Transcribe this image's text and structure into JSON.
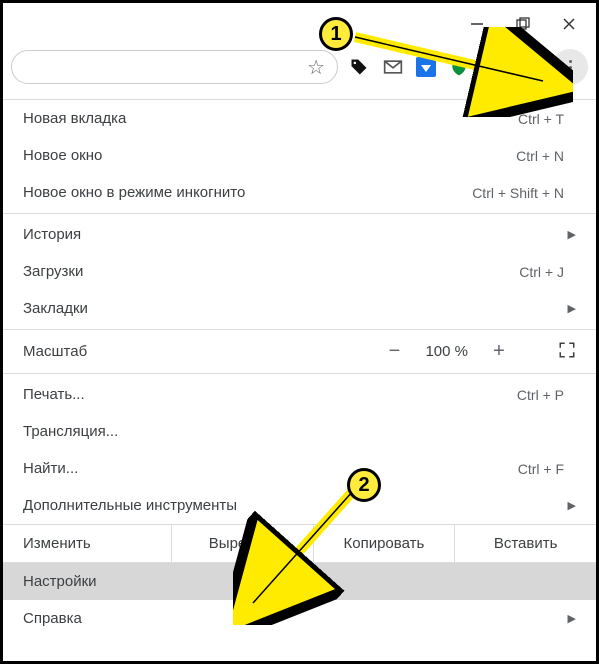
{
  "window": {
    "minimize": "—",
    "maximize": "❐",
    "close": "✕"
  },
  "toolbar": {
    "star": "☆"
  },
  "menu": {
    "new_tab": {
      "label": "Новая вкладка",
      "shortcut": "Ctrl + T"
    },
    "new_window": {
      "label": "Новое окно",
      "shortcut": "Ctrl + N"
    },
    "incognito": {
      "label": "Новое окно в режиме инкогнито",
      "shortcut": "Ctrl + Shift + N"
    },
    "history": {
      "label": "История"
    },
    "downloads": {
      "label": "Загрузки",
      "shortcut": "Ctrl + J"
    },
    "bookmarks": {
      "label": "Закладки"
    },
    "zoom_label": "Масштаб",
    "zoom_minus": "−",
    "zoom_value": "100 %",
    "zoom_plus": "+",
    "print": {
      "label": "Печать...",
      "shortcut": "Ctrl + P"
    },
    "cast": {
      "label": "Трансляция..."
    },
    "find": {
      "label": "Найти...",
      "shortcut": "Ctrl + F"
    },
    "more_tools": {
      "label": "Дополнительные инструменты"
    },
    "edit": {
      "label": "Изменить",
      "cut": "Вырезать",
      "copy": "Копировать",
      "paste": "Вставить"
    },
    "settings": {
      "label": "Настройки"
    },
    "help": {
      "label": "Справка"
    }
  },
  "annotations": {
    "marker1": "1",
    "marker2": "2"
  }
}
